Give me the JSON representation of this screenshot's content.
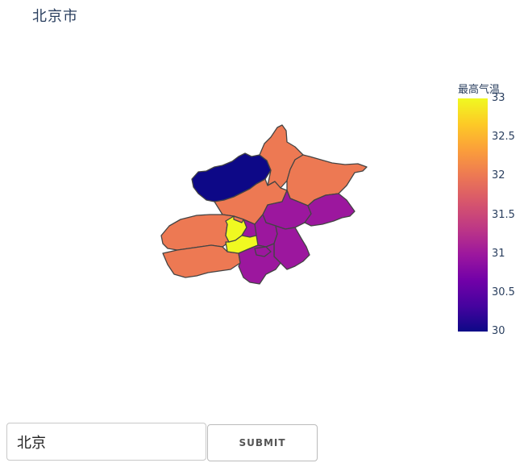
{
  "map": {
    "title": "北京市",
    "colorbar": {
      "title": "最高气温",
      "colorscale": "plasma",
      "range": [
        30,
        33
      ],
      "ticks": [
        "30",
        "30.5",
        "31",
        "31.5",
        "32",
        "32.5",
        "33"
      ]
    },
    "regions": [
      {
        "value": 32
      },
      {
        "value": 32
      },
      {
        "value": 30
      },
      {
        "value": 32
      },
      {
        "value": 32
      },
      {
        "value": 31
      },
      {
        "value": 31
      },
      {
        "value": 32
      },
      {
        "value": 31
      },
      {
        "value": 31
      },
      {
        "value": 31
      },
      {
        "value": 33
      },
      {
        "value": 33
      },
      {
        "value": 31
      },
      {
        "value": 31
      },
      {
        "value": 32
      }
    ]
  },
  "form": {
    "city_value": "北京",
    "submit_label": "SUBMIT"
  }
}
